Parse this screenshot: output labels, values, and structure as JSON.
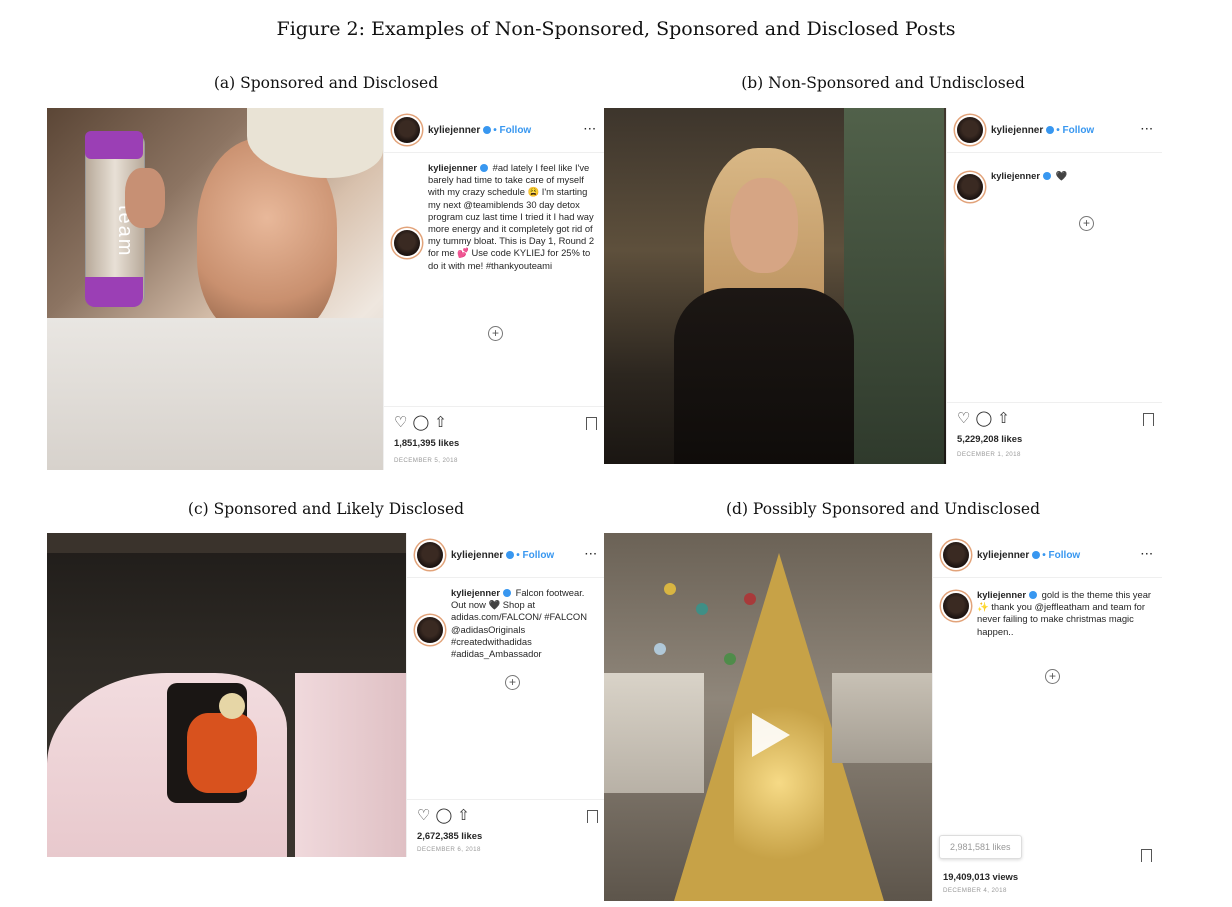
{
  "figure_title": "Figure 2: Examples of Non-Sponsored, Sponsored and Disclosed Posts",
  "panels": [
    {
      "subcaption": "(a) Sponsored and Disclosed",
      "username": "kyliejenner",
      "follow": "• Follow",
      "more": "···",
      "caption_user": "kyliejenner",
      "caption": "#ad lately I feel like I've barely had time to take care of myself with my crazy schedule 😩 I'm starting my next @teamiblends 30 day detox program cuz last time I tried it I had way more energy and it completely got rid of my tummy bloat. This is Day 1, Round 2 for me 💕 Use code KYLIEJ for 25% to do it with me! #thankyouteami",
      "likes": "1,851,395 likes",
      "date": "DECEMBER 5, 2018",
      "bottle_text": "team"
    },
    {
      "subcaption": "(b) Non-Sponsored and Undisclosed",
      "username": "kyliejenner",
      "follow": "• Follow",
      "more": "···",
      "caption_user": "kyliejenner",
      "caption": "🖤",
      "likes": "5,229,208 likes",
      "date": "DECEMBER 1, 2018"
    },
    {
      "subcaption": "(c) Sponsored and Likely Disclosed",
      "username": "kyliejenner",
      "follow": "• Follow",
      "more": "···",
      "caption_user": "kyliejenner",
      "caption": "Falcon footwear. Out now 🖤 Shop at adidas.com/FALCON/ #FALCON @adidasOriginals #createdwithadidas #adidas_Ambassador",
      "likes": "2,672,385 likes",
      "date": "DECEMBER 6, 2018"
    },
    {
      "subcaption": "(d) Possibly Sponsored and Undisclosed",
      "username": "kyliejenner",
      "follow": "• Follow",
      "more": "···",
      "caption_user": "kyliejenner",
      "caption": "gold is the theme this year ✨ thank you @jeffleatham and team for never failing to make christmas magic happen..",
      "likes_tooltip": "2,981,581 likes",
      "views": "19,409,013 views",
      "date": "DECEMBER 4, 2018"
    }
  ],
  "icons": {
    "heart": "heart-icon",
    "comment": "comment-icon",
    "share": "share-icon",
    "save": "bookmark-icon",
    "add": "plus-circle-icon",
    "play": "play-icon"
  }
}
